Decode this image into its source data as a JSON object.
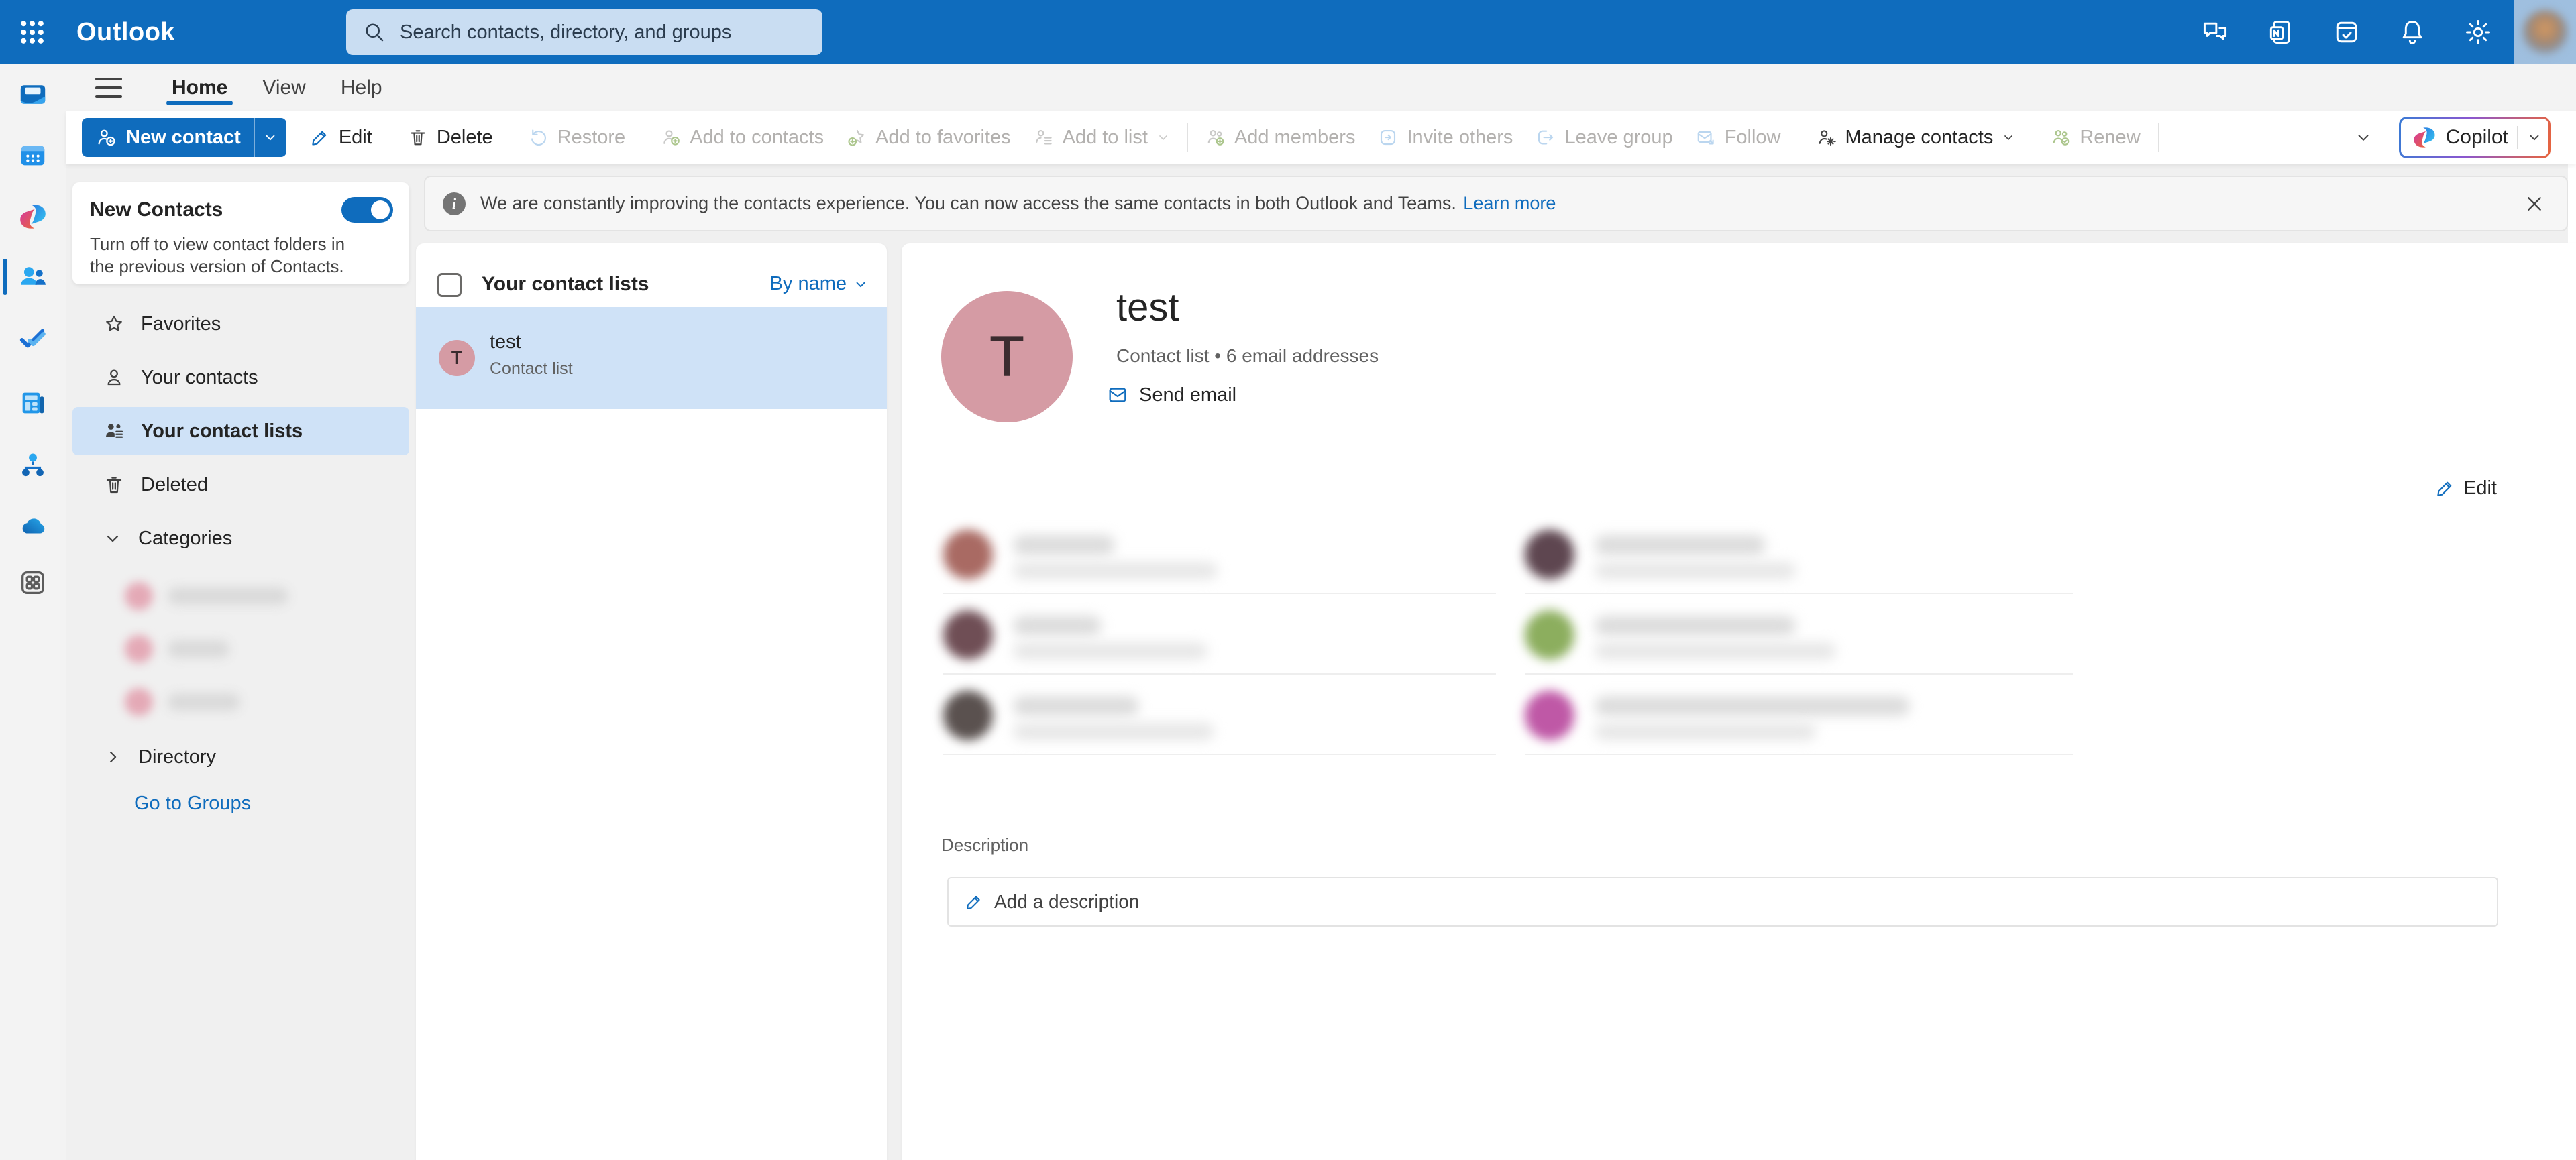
{
  "app": {
    "name": "Outlook"
  },
  "header": {
    "search_placeholder": "Search contacts, directory, and groups",
    "icons": [
      "chat",
      "onenote-feed",
      "todo",
      "notifications",
      "settings"
    ]
  },
  "menu": {
    "tabs": [
      "Home",
      "View",
      "Help"
    ],
    "active_tab": "Home"
  },
  "toolbar": {
    "new_contact_label": "New contact",
    "items": [
      {
        "label": "Edit",
        "enabled": true
      },
      {
        "label": "Delete",
        "enabled": true
      },
      {
        "label": "Restore",
        "enabled": false
      },
      {
        "label": "Add to contacts",
        "enabled": false
      },
      {
        "label": "Add to favorites",
        "enabled": false
      },
      {
        "label": "Add to list",
        "enabled": false,
        "has_dropdown": true
      },
      {
        "label": "Add members",
        "enabled": false
      },
      {
        "label": "Invite others",
        "enabled": false
      },
      {
        "label": "Leave group",
        "enabled": false
      },
      {
        "label": "Follow",
        "enabled": false
      },
      {
        "label": "Manage contacts",
        "enabled": true,
        "has_dropdown": true
      },
      {
        "label": "Renew",
        "enabled": false
      }
    ],
    "copilot_label": "Copilot"
  },
  "left_rail": {
    "icons": [
      "mail",
      "calendar",
      "copilot",
      "people",
      "todo",
      "newsletters",
      "groups",
      "onedrive",
      "more-apps"
    ],
    "selected": "people"
  },
  "sidebar": {
    "new_contacts": {
      "title": "New Contacts",
      "toggle_on": true,
      "description": "Turn off to view contact folders in the previous version of Contacts."
    },
    "items": [
      {
        "label": "Favorites",
        "selected": false
      },
      {
        "label": "Your contacts",
        "selected": false
      },
      {
        "label": "Your contact lists",
        "selected": true
      },
      {
        "label": "Deleted",
        "selected": false
      }
    ],
    "categories_label": "Categories",
    "category_dot_color": "#e4a9b6",
    "blurred_category_count": 3,
    "directory_label": "Directory",
    "go_to_groups_label": "Go to Groups"
  },
  "banner": {
    "text": "We are constantly improving the contacts experience. You can now access the same contacts in both Outlook and Teams.",
    "link": "Learn more"
  },
  "list_panel": {
    "title": "Your contact lists",
    "sort_label": "By name",
    "items": [
      {
        "initial": "T",
        "name": "test",
        "type": "Contact list",
        "selected": true,
        "avatar_color": "#d59ba4"
      }
    ]
  },
  "detail": {
    "initial": "T",
    "name": "test",
    "meta": "Contact list • 6 email addresses",
    "send_email_label": "Send email",
    "edit_label": "Edit",
    "member_count": 6,
    "member_avatar_colors": [
      "#a96a63",
      "#6f4e55",
      "#5a514f",
      "#5e4650",
      "#8cae5e",
      "#bf58a6"
    ],
    "description_label": "Description",
    "add_description_label": "Add a description"
  },
  "colors": {
    "accent": "#0f6cbd",
    "header": "#0f6cbd",
    "selection": "#cfe2f7",
    "avatar_pink": "#d59ba4"
  }
}
